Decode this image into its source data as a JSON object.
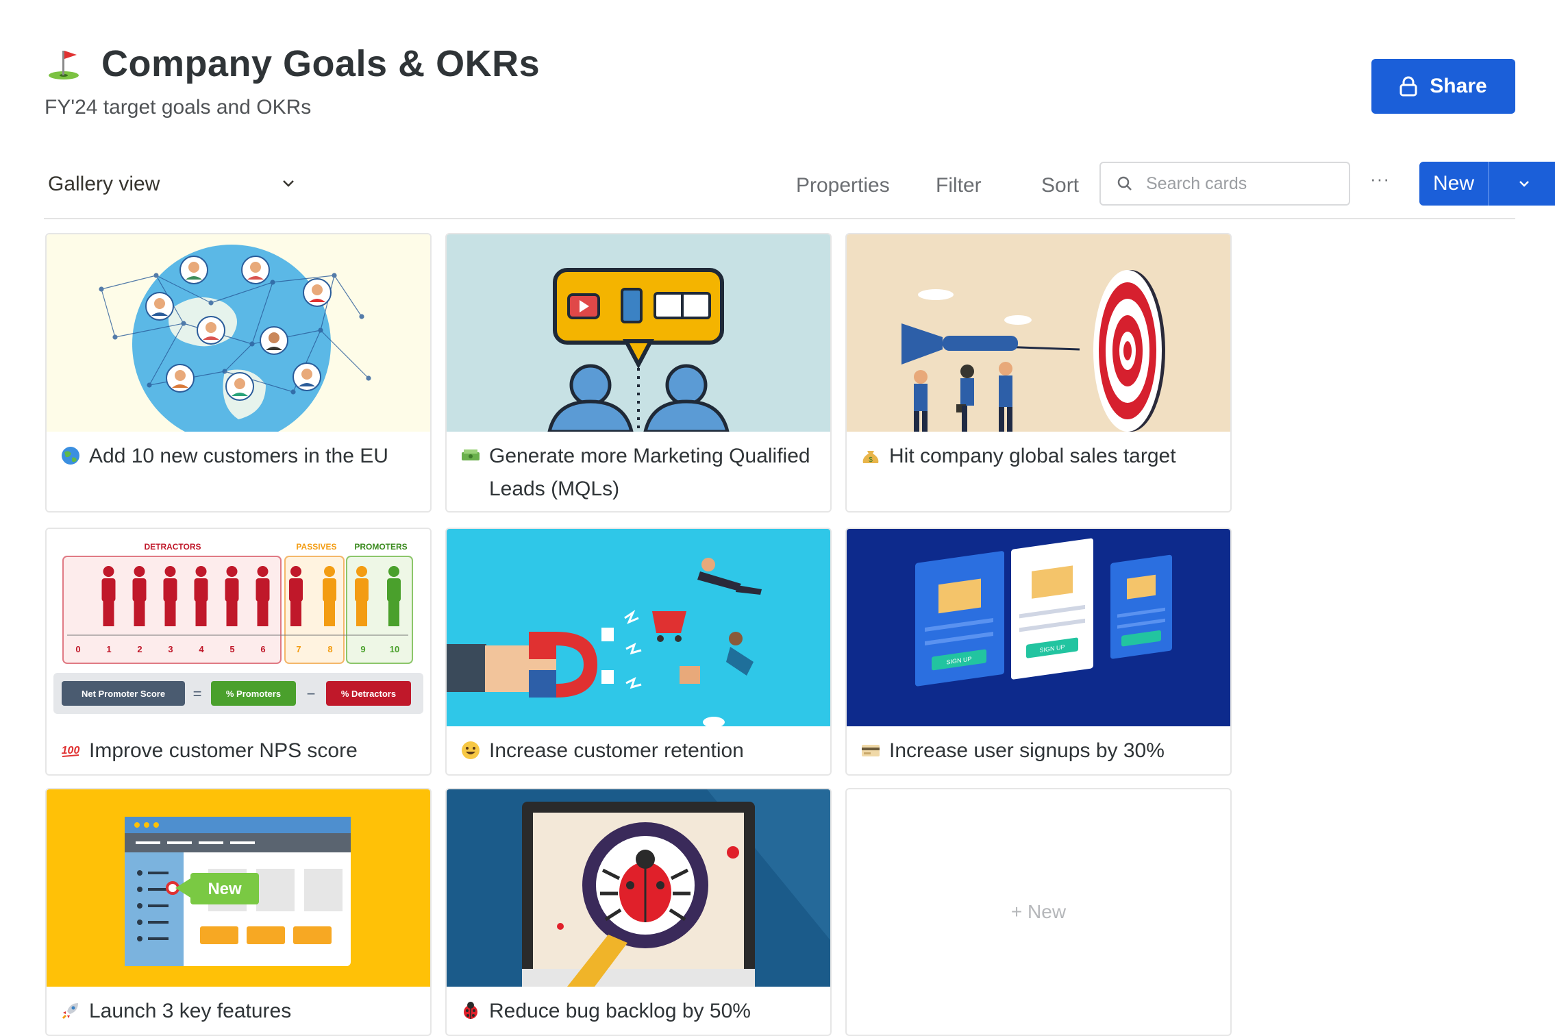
{
  "header": {
    "title": "Company Goals & OKRs",
    "subtitle": "FY'24 target goals and OKRs",
    "title_icon": "golf-flag-icon",
    "share_label": "Share"
  },
  "toolbar": {
    "view_label": "Gallery view",
    "properties_label": "Properties",
    "filter_label": "Filter",
    "sort_label": "Sort",
    "search_placeholder": "Search cards",
    "more_label": "···",
    "new_label": "New"
  },
  "cards": [
    {
      "label": "Add 10 new customers in the EU",
      "emoji": "globe-icon"
    },
    {
      "label": "Generate more Marketing Qualified Leads (MQLs)",
      "emoji": "money-bills-icon"
    },
    {
      "label": "Hit company global sales target",
      "emoji": "money-bag-icon"
    },
    {
      "label": "Improve customer NPS score",
      "emoji": "hundred-points-icon"
    },
    {
      "label": "Increase customer retention",
      "emoji": "grinning-face-icon"
    },
    {
      "label": "Increase user signups by 30%",
      "emoji": "credit-card-icon"
    },
    {
      "label": "Launch 3 key features",
      "emoji": "rocket-icon"
    },
    {
      "label": "Reduce bug backlog by 50%",
      "emoji": "ladybug-icon"
    }
  ],
  "nps_cover": {
    "detractors": "DETRACTORS",
    "passives": "PASSIVES",
    "promoters": "PROMOTERS",
    "scale": [
      "0",
      "1",
      "2",
      "3",
      "4",
      "5",
      "6",
      "7",
      "8",
      "9",
      "10"
    ],
    "formula_nps": "Net Promoter Score",
    "formula_promoters": "% Promoters",
    "formula_detractors": "% Detractors"
  },
  "signup_cover": {
    "button": "SIGN UP"
  },
  "features_cover": {
    "badge": "New"
  },
  "new_card_label": "+ New",
  "colors": {
    "accent": "#1b5fd9",
    "border": "#e6e6e6"
  }
}
